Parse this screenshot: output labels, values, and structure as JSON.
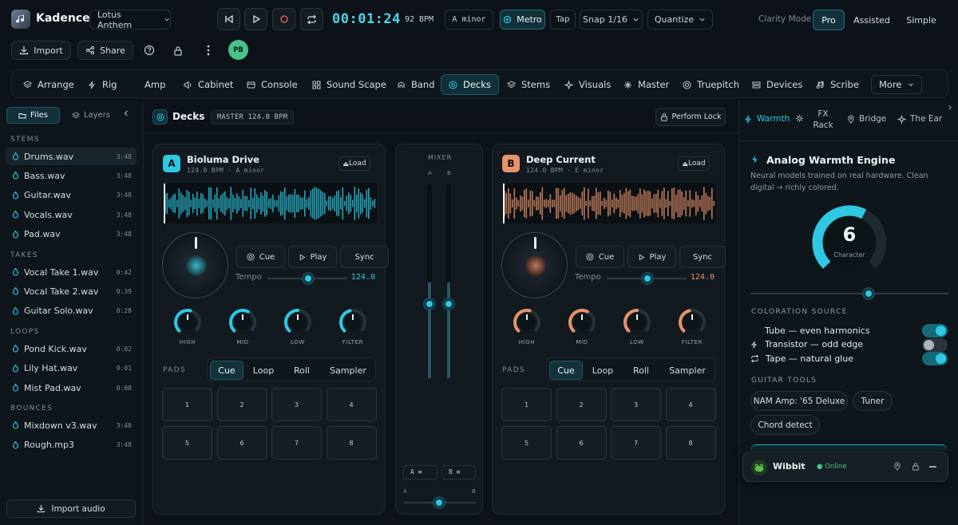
{
  "app": {
    "name": "Kadence",
    "project": "Lotus Anthem"
  },
  "transport": {
    "time": "00:01:24",
    "bpm": "92 BPM",
    "key": "A minor",
    "metro": "Metro",
    "tap": "Tap",
    "snap": "Snap 1/16",
    "quantize": "Quantize"
  },
  "clarity": {
    "label": "Clarity Mode",
    "options": [
      "Pro",
      "Assisted",
      "Simple"
    ],
    "active": "Pro"
  },
  "toolbar": {
    "import": "Import",
    "share": "Share",
    "avatar": "PB"
  },
  "nav": [
    "Arrange",
    "Rig",
    "Amp",
    "Cabinet",
    "Console",
    "Sound Scape",
    "Band",
    "Decks",
    "Stems",
    "Visuals",
    "Master",
    "Truepitch",
    "Devices",
    "Scribe"
  ],
  "nav_more": "More",
  "sidebar": {
    "tabs": [
      "Files",
      "Layers"
    ],
    "sections": [
      {
        "title": "STEMS",
        "files": [
          {
            "name": "Drums.wav",
            "dur": "3:48"
          },
          {
            "name": "Bass.wav",
            "dur": "3:48"
          },
          {
            "name": "Guitar.wav",
            "dur": "3:48"
          },
          {
            "name": "Vocals.wav",
            "dur": "3:48"
          },
          {
            "name": "Pad.wav",
            "dur": "3:48"
          }
        ]
      },
      {
        "title": "TAKES",
        "files": [
          {
            "name": "Vocal Take 1.wav",
            "dur": "0:42"
          },
          {
            "name": "Vocal Take 2.wav",
            "dur": "0:39"
          },
          {
            "name": "Guitar Solo.wav",
            "dur": "0:28"
          }
        ]
      },
      {
        "title": "LOOPS",
        "files": [
          {
            "name": "Pond Kick.wav",
            "dur": "0:02"
          },
          {
            "name": "Lily Hat.wav",
            "dur": "0:01"
          },
          {
            "name": "Mist Pad.wav",
            "dur": "0:08"
          }
        ]
      },
      {
        "title": "BOUNCES",
        "files": [
          {
            "name": "Mixdown v3.wav",
            "dur": "3:48"
          },
          {
            "name": "Rough.mp3",
            "dur": "3:48"
          }
        ]
      }
    ],
    "import_audio": "Import audio"
  },
  "decks_header": {
    "title": "Decks",
    "master": "MASTER 124.0 BPM",
    "perform_lock": "Perform Lock"
  },
  "colors": {
    "deckA": "#2ec8e2",
    "deckB": "#e8936c",
    "accent": "#2ec8e2"
  },
  "deckA": {
    "badge": "A",
    "title": "Bioluma Drive",
    "sub": "124.0 BPM · A minor",
    "load": "Load",
    "cue": "Cue",
    "play": "Play",
    "sync": "Sync",
    "tempo_label": "Tempo",
    "tempo": "124.0",
    "knobs": [
      "HIGH",
      "MID",
      "LOW",
      "FILTER"
    ],
    "pads_label": "PADS",
    "pad_modes": [
      "Cue",
      "Loop",
      "Roll",
      "Sampler"
    ],
    "pads": [
      "1",
      "2",
      "3",
      "4",
      "5",
      "6",
      "7",
      "8"
    ]
  },
  "deckB": {
    "badge": "B",
    "title": "Deep Current",
    "sub": "124.0 BPM · E minor",
    "load": "Load",
    "cue": "Cue",
    "play": "Play",
    "sync": "Sync",
    "tempo_label": "Tempo",
    "tempo": "124.0",
    "knobs": [
      "HIGH",
      "MID",
      "LOW",
      "FILTER"
    ],
    "pads_label": "PADS",
    "pad_modes": [
      "Cue",
      "Loop",
      "Roll",
      "Sampler"
    ],
    "pads": [
      "1",
      "2",
      "3",
      "4",
      "5",
      "6",
      "7",
      "8"
    ]
  },
  "mixer": {
    "title": "MIXER",
    "ch_a": "A",
    "ch_b": "B",
    "sel_a": "A",
    "sel_b": "B",
    "xf_a": "A",
    "xf_b": "B"
  },
  "right": {
    "tabs": [
      "Warmth",
      "FX Rack",
      "Bridge",
      "The Ear"
    ],
    "engine_title": "Analog Warmth Engine",
    "engine_desc": "Neural models trained on real hardware. Clean digital → richly colored.",
    "character_value": "6",
    "character_label": "Character",
    "coloration_title": "COLORATION SOURCE",
    "sources": [
      {
        "label": "Tube — even harmonics",
        "on": true
      },
      {
        "label": "Transistor — odd edge",
        "on": false
      },
      {
        "label": "Tape — natural glue",
        "on": true
      }
    ],
    "guitar_title": "GUITAR TOOLS",
    "guitar_tools": [
      "NAM Amp: '65 Deluxe",
      "Tuner",
      "Chord detect"
    ]
  },
  "wibbit": {
    "name": "Wibbit",
    "status": "Online"
  }
}
